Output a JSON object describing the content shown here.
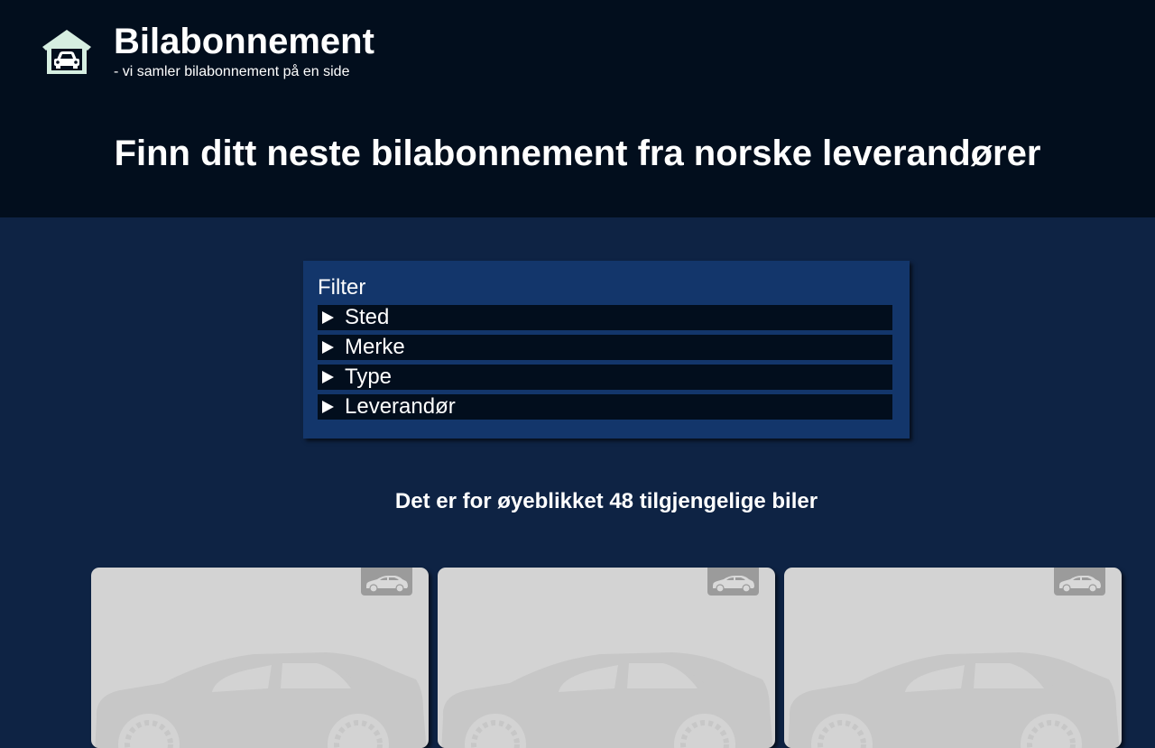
{
  "header": {
    "brand_title": "Bilabonnement",
    "brand_subtitle": "- vi samler bilabonnement på en side",
    "hero_heading": "Finn ditt neste bilabonnement fra norske leverandører",
    "logo_icon": "garage-car-icon"
  },
  "filter": {
    "title": "Filter",
    "sections": [
      {
        "label": "Sted",
        "expanded": false
      },
      {
        "label": "Merke",
        "expanded": false
      },
      {
        "label": "Type",
        "expanded": false
      },
      {
        "label": "Leverandør",
        "expanded": false
      }
    ]
  },
  "results": {
    "count_text": "Det er for øyeblikket 48 tilgjengelige biler"
  },
  "cards": [
    {
      "image": "car-placeholder-image",
      "badge_icon": "car-icon"
    },
    {
      "image": "car-placeholder-image",
      "badge_icon": "car-icon"
    },
    {
      "image": "car-placeholder-image",
      "badge_icon": "car-icon"
    }
  ],
  "colors": {
    "header_bg": "#020e1d",
    "page_bg": "#0e2344",
    "filter_bg": "#13366b",
    "logo_accent": "#d6eee1",
    "card_bg": "#d3d3d3"
  }
}
